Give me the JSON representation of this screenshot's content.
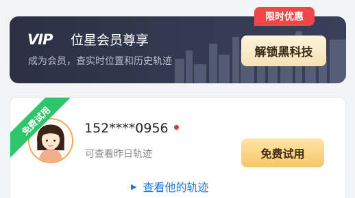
{
  "vip": {
    "mark": "VIP",
    "title": "位星会员尊享",
    "subtitle": "成为会员，查实时位置和历史轨迹",
    "unlock_label": "解锁黑科技",
    "promo_badge": "限时优惠"
  },
  "member": {
    "ribbon": "免费试用",
    "phone": "152****0956",
    "hint": "可查看昨日轨迹",
    "trial_label": "免费试用",
    "view_link": "查看他的轨迹",
    "link_icon": "play-triangle-icon",
    "avatar_icon": "user-avatar-icon"
  },
  "colors": {
    "banner_bg": "#2b3043",
    "accent_gold": "#f6c667",
    "badge_red": "#f0464a",
    "ribbon_green": "#2ec66a",
    "link_blue": "#2076d9",
    "status_dot": "#e7343b"
  }
}
